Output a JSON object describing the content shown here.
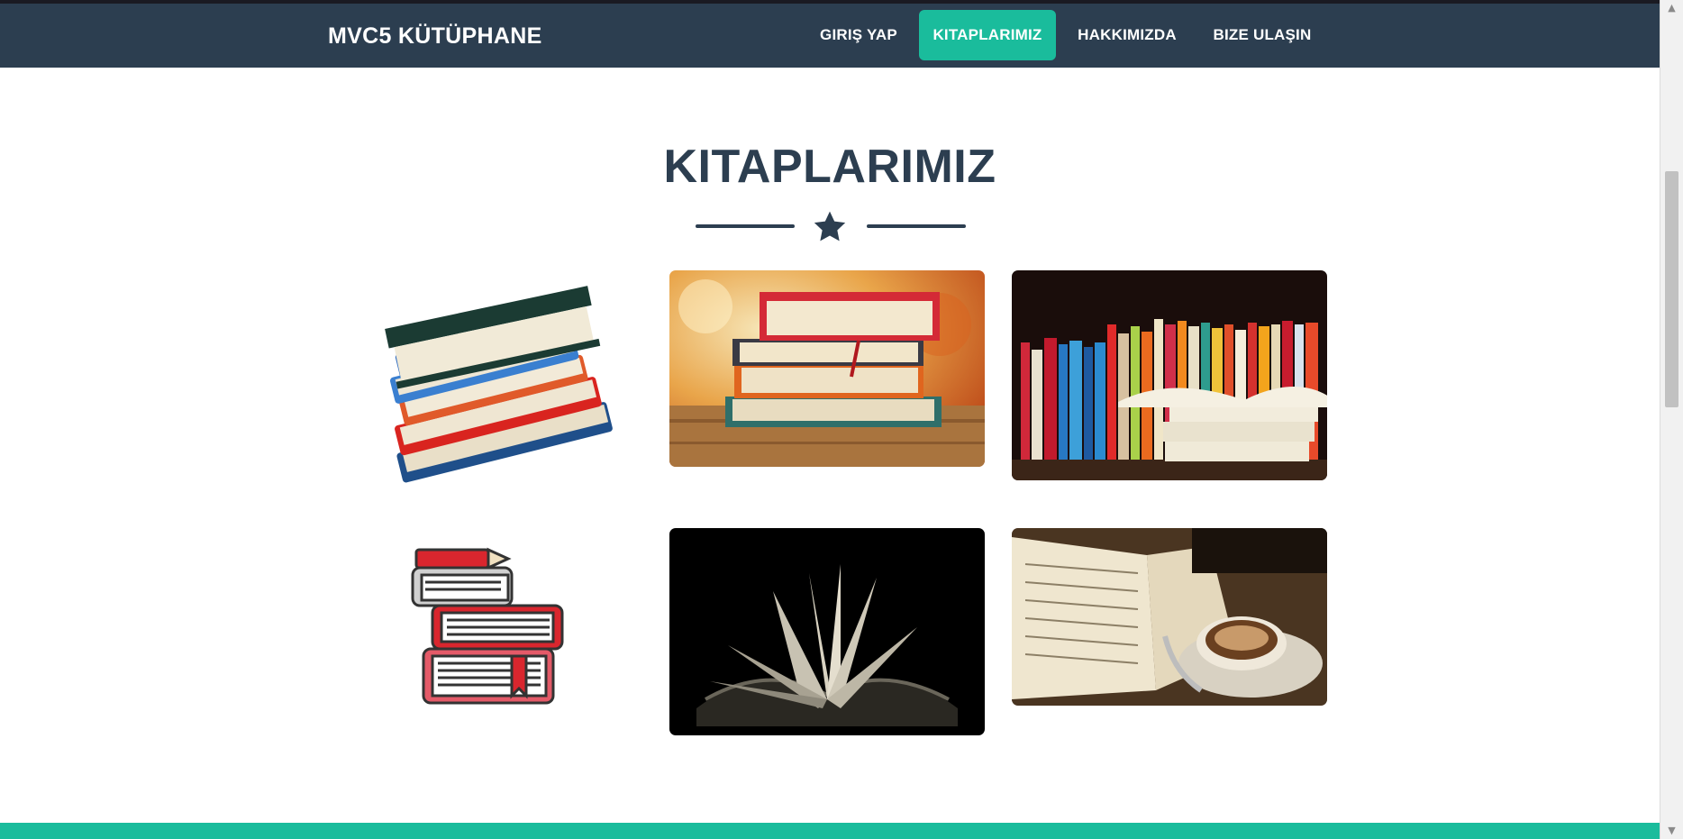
{
  "navbar": {
    "brand": "MVC5 KÜTÜPHANE",
    "items": [
      {
        "label": "GIRIŞ YAP",
        "active": false
      },
      {
        "label": "KITAPLARIMIZ",
        "active": true
      },
      {
        "label": "HAKKIMIZDA",
        "active": false
      },
      {
        "label": "BIZE ULAŞIN",
        "active": false
      }
    ]
  },
  "portfolio": {
    "heading": "KITAPLARIMIZ",
    "divider_icon": "star-icon",
    "items": [
      {
        "image": "book-stack-illustration"
      },
      {
        "image": "books-on-table-photo"
      },
      {
        "image": "bookshelf-open-book-photo"
      },
      {
        "image": "book-pencil-icon"
      },
      {
        "image": "open-book-dark-photo"
      },
      {
        "image": "book-coffee-photo"
      }
    ]
  },
  "colors": {
    "navbar": "#2c3e50",
    "accent": "#1abc9c",
    "heading": "#2c3e50",
    "background": "#ffffff"
  }
}
